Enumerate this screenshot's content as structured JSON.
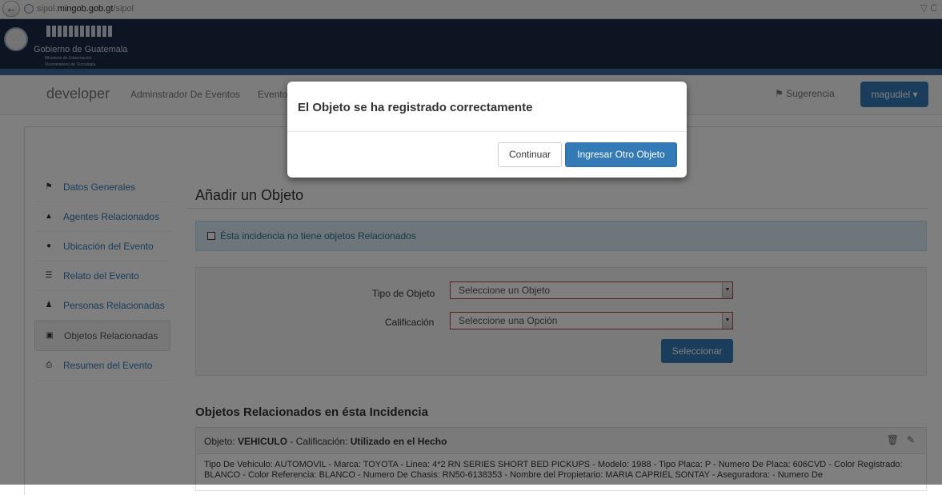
{
  "browser": {
    "url_prefix": "sipol.",
    "url_domain": "mingob.gob.gt",
    "url_path": "/sipol",
    "right_icons": "▽ C"
  },
  "gov": {
    "title": "Gobierno de Guatemala",
    "sub1": "Ministerio de Gobernación",
    "sub2": "Viceministerio de Tecnología"
  },
  "navbar": {
    "brand": "developer",
    "links": [
      "Adminstrador De Eventos",
      "Evento"
    ],
    "suggest": "Sugerencia",
    "user": "magudiel ▾"
  },
  "sidebar": {
    "items": [
      {
        "label": "Datos Generales",
        "icon": "flag-icon"
      },
      {
        "label": "Agentes Relacionados",
        "icon": "bell-icon"
      },
      {
        "label": "Ubicación del Evento",
        "icon": "map-marker-icon"
      },
      {
        "label": "Relato del Evento",
        "icon": "list-icon"
      },
      {
        "label": "Personas Relacionadas",
        "icon": "user-icon"
      },
      {
        "label": "Objetos Relacionadas",
        "icon": "briefcase-icon"
      },
      {
        "label": "Resumen del Evento",
        "icon": "print-icon"
      }
    ],
    "active_index": 5
  },
  "main": {
    "heading": "Añadir un Objeto",
    "no_objects_label": "Ésta incidencia no tiene objetos Relacionados",
    "form": {
      "tipo_label": "Tipo de Objeto",
      "tipo_value": "Seleccione un Objeto",
      "calif_label": "Calificación",
      "calif_value": "Seleccione una Opción",
      "select_button": "Seleccionar"
    },
    "section_heading": "Objetos Relacionados en ésta Incidencia",
    "object": {
      "obj_prefix": "Objeto: ",
      "obj_value": "VEHICULO",
      "calif_prefix": " - Calificación: ",
      "calif_value": "Utilizado en el Hecho",
      "details": "Tipo De Vehiculo: AUTOMOVIL - Marca: TOYOTA - Linea: 4*2 RN SERIES SHORT BED PICKUPS - Modelo: 1988 - Tipo Placa: P - Numero De Placa: 606CVD - Color Registrado: BLANCO - Color Referencia: BLANCO - Numero De Chasis: RN50-6138353 - Nombre del Propietario: MARIA CAPRIEL SONTAY - Aseguradora: - Numero De"
    }
  },
  "modal": {
    "title": "El Objeto se ha registrado correctamente",
    "continue_button": "Continuar",
    "another_button": "Ingresar Otro Objeto"
  }
}
